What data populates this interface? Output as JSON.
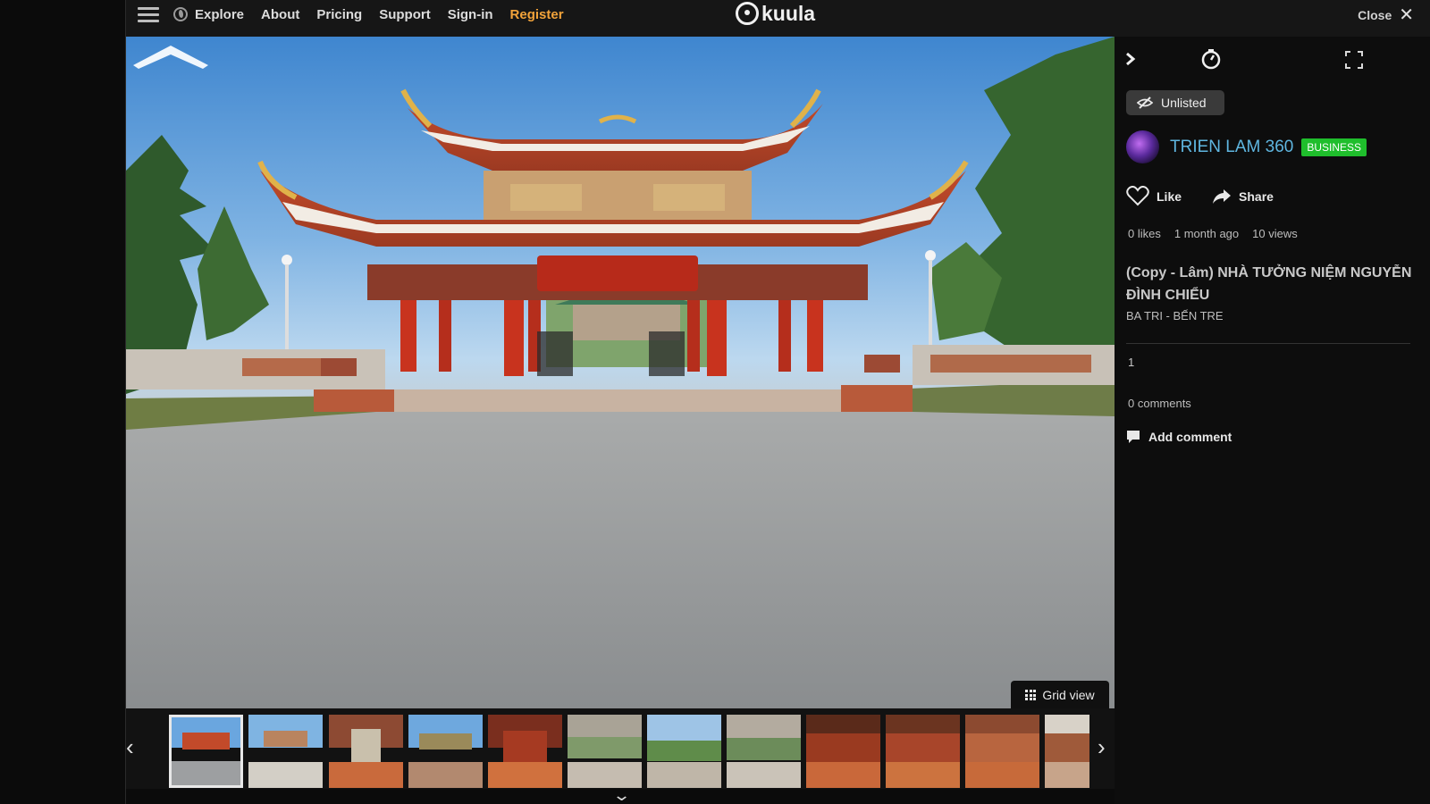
{
  "nav": {
    "explore": "Explore",
    "about": "About",
    "pricing": "Pricing",
    "support": "Support",
    "signin": "Sign-in",
    "register": "Register"
  },
  "logo": {
    "text": "kuula"
  },
  "close_label": "Close",
  "viewer": {
    "grid_view_label": "Grid view",
    "thumbnail_count": 12,
    "active_thumbnail": 1
  },
  "panel": {
    "visibility": "Unlisted",
    "username": "TRIEN LAM 360",
    "badge": "BUSINESS",
    "like_label": "Like",
    "share_label": "Share",
    "likes": "0 likes",
    "posted": "1 month ago",
    "views": "10 views",
    "title": "(Copy - Lâm) NHÀ TƯỞNG NIỆM NGUYỄN ĐÌNH CHIỂU",
    "location": "BA TRI - BẾN TRE",
    "count": "1",
    "comments": "0 comments",
    "add_comment": "Add comment"
  },
  "colors": {
    "register": "#f2a33a",
    "username": "#5fb6e0",
    "badge": "#1fbe2c"
  }
}
